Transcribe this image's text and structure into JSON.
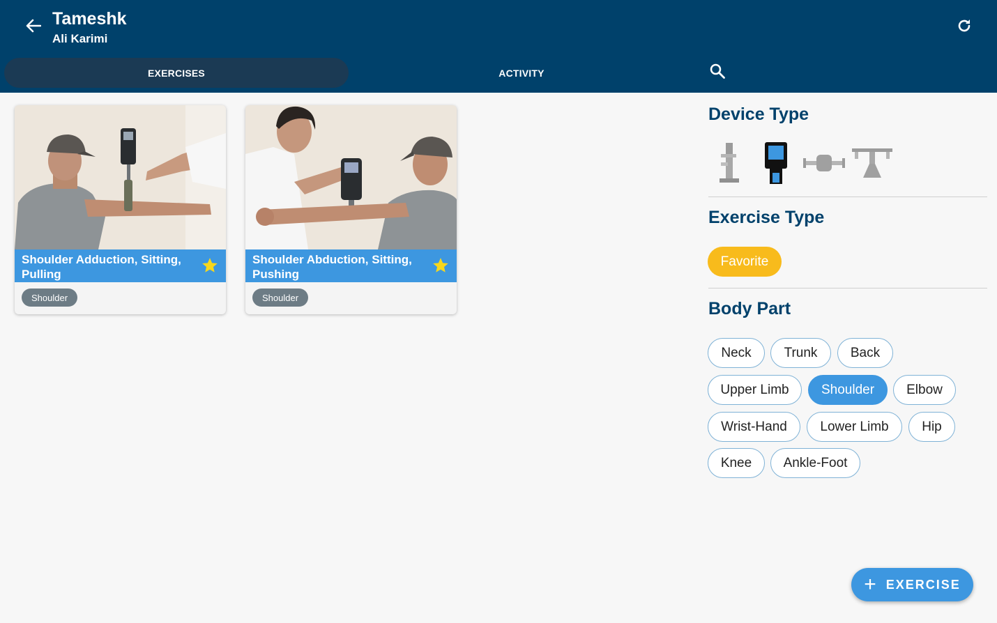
{
  "header": {
    "title": "Tameshk",
    "subtitle": "Ali Karimi",
    "back_icon": "arrow-left-icon",
    "refresh_icon": "refresh-icon"
  },
  "tabs": [
    {
      "label": "EXERCISES",
      "selected": true
    },
    {
      "label": "ACTIVITY",
      "selected": false
    }
  ],
  "search_icon": "search-icon",
  "exercises": [
    {
      "title": "Shoulder Adduction, Sitting, Pulling",
      "tag": "Shoulder",
      "favorite": true
    },
    {
      "title": "Shoulder Abduction, Sitting, Pushing",
      "tag": "Shoulder",
      "favorite": true
    }
  ],
  "filters": {
    "device_type": {
      "title": "Device Type",
      "devices": [
        {
          "icon": "vertical-stand-device-icon",
          "selected": false
        },
        {
          "icon": "handheld-dynamometer-icon",
          "selected": true
        },
        {
          "icon": "horizontal-dynamometer-icon",
          "selected": false
        },
        {
          "icon": "table-platform-device-icon",
          "selected": false
        }
      ]
    },
    "exercise_type": {
      "title": "Exercise Type",
      "chips": [
        {
          "label": "Favorite",
          "selected": true
        }
      ]
    },
    "body_part": {
      "title": "Body Part",
      "chips": [
        {
          "label": "Neck",
          "selected": false
        },
        {
          "label": "Trunk",
          "selected": false
        },
        {
          "label": "Back",
          "selected": false
        },
        {
          "label": "Upper Limb",
          "selected": false
        },
        {
          "label": "Shoulder",
          "selected": true
        },
        {
          "label": "Elbow",
          "selected": false
        },
        {
          "label": "Wrist-Hand",
          "selected": false
        },
        {
          "label": "Lower Limb",
          "selected": false
        },
        {
          "label": "Hip",
          "selected": false
        },
        {
          "label": "Knee",
          "selected": false
        },
        {
          "label": "Ankle-Foot",
          "selected": false
        }
      ]
    }
  },
  "fab": {
    "plus": "+",
    "label": "EXERCISE"
  },
  "colors": {
    "header": "#00416b",
    "selected_tab": "#1b3a54",
    "accent": "#3d97e0",
    "favorite": "#f8bb1c",
    "tag": "#6d7c85"
  }
}
